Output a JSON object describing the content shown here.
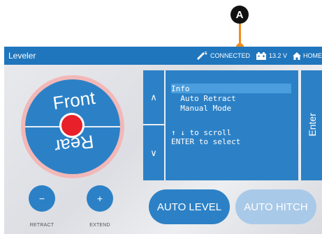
{
  "callout": {
    "label": "A"
  },
  "header": {
    "title": "Leveler",
    "connection_status": "CONNECTED",
    "battery_voltage": "13.2 V",
    "home_label": "HOME"
  },
  "dial": {
    "front_label": "Front",
    "rear_label": "Rear"
  },
  "controls": {
    "retract_symbol": "−",
    "retract_label": "RETRACT",
    "extend_symbol": "+",
    "extend_label": "EXTEND"
  },
  "menu": {
    "up_symbol": "∧",
    "down_symbol": "∨",
    "items": [
      "Info",
      "  Auto Retract",
      "  Manual Mode"
    ],
    "selected_index": 0,
    "help_lines": [
      "↑ ↓ to scroll",
      "ENTER to select"
    ],
    "enter_label": "Enter"
  },
  "actions": {
    "auto_level_label": "AUTO LEVEL",
    "auto_hitch_label": "AUTO HITCH"
  },
  "colors": {
    "header": "#1f76bd",
    "primary": "#2c81c6",
    "disabled": "#a9c9e8",
    "bubble": "#e8202a",
    "callout_line": "#f28c1e"
  }
}
